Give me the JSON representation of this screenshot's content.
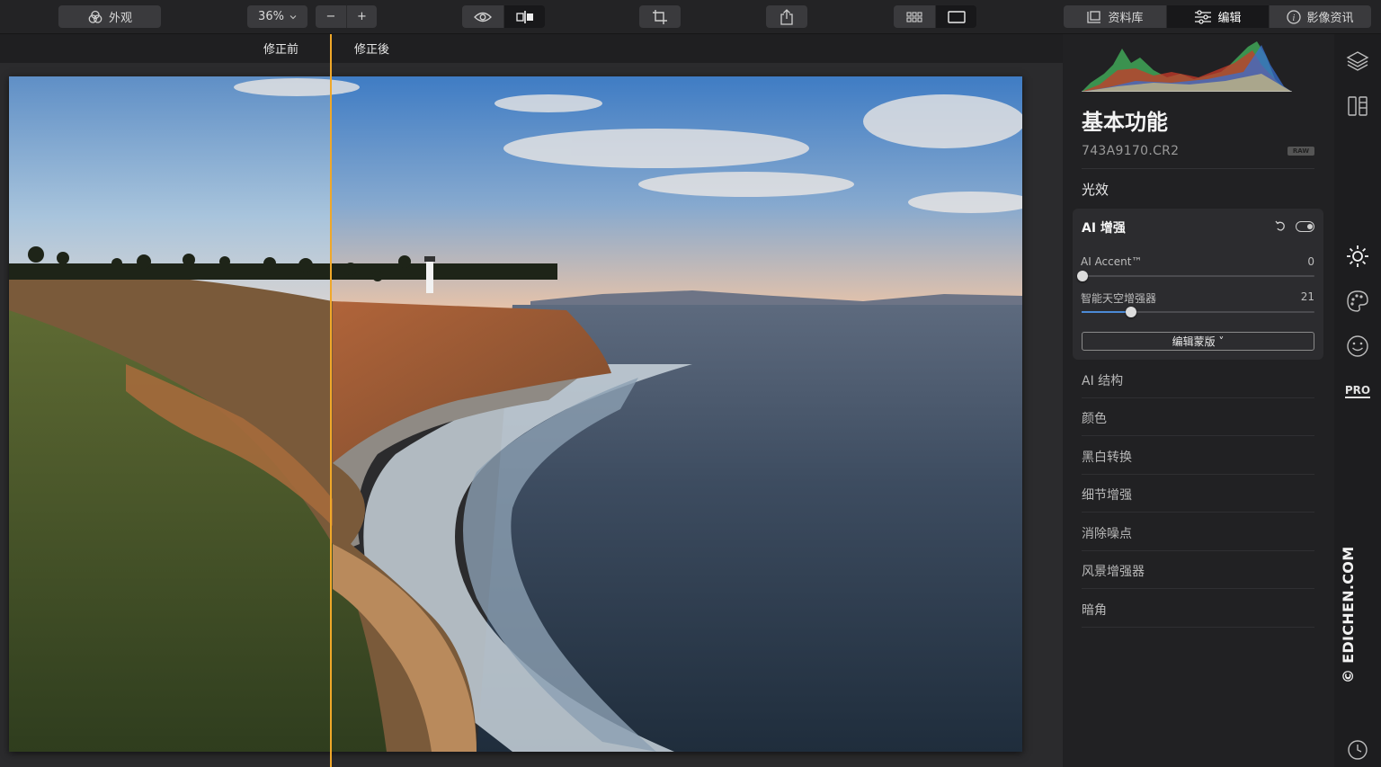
{
  "toolbar": {
    "looks_label": "外观",
    "zoom_value": "36%",
    "zoom_out": "−",
    "zoom_in": "+",
    "library_label": "资料库",
    "edit_label": "编辑",
    "info_label": "影像资讯"
  },
  "compare": {
    "before_label": "修正前",
    "after_label": "修正後"
  },
  "panel": {
    "title": "基本功能",
    "filename": "743A9170.CR2",
    "raw_badge": "RAW",
    "section": "光效",
    "ai_enhance": {
      "title": "AI 增强",
      "sliders": [
        {
          "label": "AI Accent™",
          "value": 0
        },
        {
          "label": "智能天空增强器",
          "value": 21
        }
      ],
      "mask_button": "编辑蒙版 ˅"
    },
    "tools": [
      "AI 结构",
      "颜色",
      "黑白转换",
      "细节增强",
      "消除噪点",
      "风景增强器",
      "暗角"
    ]
  },
  "rail": {
    "icons": [
      "layers-icon",
      "compare-panels-icon",
      "sun-icon",
      "palette-icon",
      "face-icon",
      "pro-badge",
      "history-icon"
    ],
    "pro_label": "PRO"
  },
  "watermark": "© EDICHEN.COM",
  "colors": {
    "accent_divider": "#f0a829",
    "slider_fill": "#4c8ad6",
    "panel_bg": "#212123",
    "canvas_bg": "#2b2b2d"
  }
}
